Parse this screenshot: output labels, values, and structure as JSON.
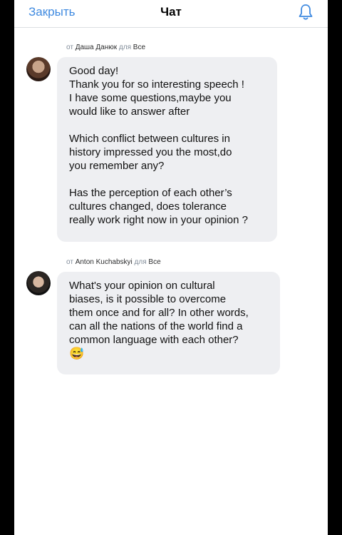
{
  "header": {
    "close_label": "Закрыть",
    "title": "Чат",
    "bell_icon": "bell-icon"
  },
  "messages": [
    {
      "prefix": "от",
      "author": "Даша Данюк",
      "recipient_prefix": "для",
      "recipient": "Все",
      "lines": [
        "Good day!",
        "Thank you for so interesting speech !",
        "I have some questions,maybe you",
        "would like to answer after",
        "",
        "Which conflict between cultures in",
        "history impressed you the most,do",
        "you remember any?",
        "",
        "Has the perception of each other’s",
        "cultures changed, does tolerance",
        "really work right now in your opinion ?"
      ]
    },
    {
      "prefix": "от",
      "author": "Anton Kuchabskyi",
      "recipient_prefix": "для",
      "recipient": "Все",
      "lines": [
        "What's your opinion on cultural",
        "biases, is it possible to overcome",
        "them once and for all? In other words,",
        "can all the nations of the world find a",
        "common language with each other?"
      ],
      "emoji": "😅"
    }
  ],
  "colors": {
    "accent": "#3f8ae0",
    "bubble": "#eeeff2",
    "meta": "#818c99"
  }
}
